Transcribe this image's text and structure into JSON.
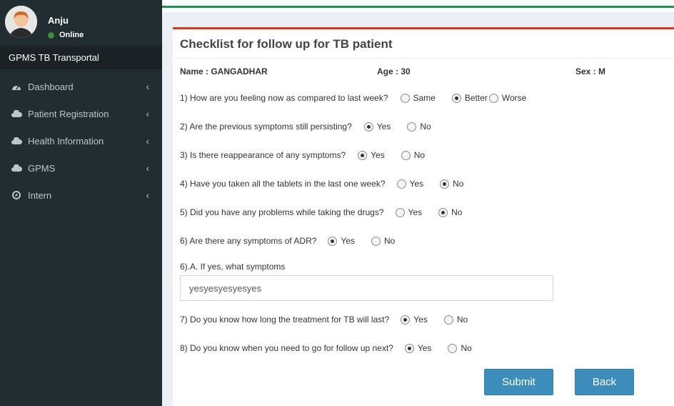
{
  "user": {
    "name": "Anju",
    "status": "Online"
  },
  "app_title": "GPMS TB Transportal",
  "menu": [
    {
      "label": "Dashboard",
      "icon": "dashboard-icon"
    },
    {
      "label": "Patient Registration",
      "icon": "cloud-icon"
    },
    {
      "label": "Health Information",
      "icon": "cloud-icon"
    },
    {
      "label": "GPMS",
      "icon": "cloud-icon"
    },
    {
      "label": "Intern",
      "icon": "compass-icon"
    }
  ],
  "form": {
    "title": "Checklist for follow up for TB patient",
    "name": "Name : GANGADHAR",
    "age": "Age : 30",
    "sex": "Sex : M",
    "q1": {
      "text": "1) How are you feeling now as compared to last week?",
      "options": [
        "Same",
        "Better",
        "Worse"
      ],
      "selected": "Better"
    },
    "q2": {
      "text": "2) Are the previous symptoms still persisting?",
      "options": [
        "Yes",
        "No"
      ],
      "selected": "Yes"
    },
    "q3": {
      "text": "3) Is there reappearance of any symptoms?",
      "options": [
        "Yes",
        "No"
      ],
      "selected": "Yes"
    },
    "q4": {
      "text": "4) Have you taken all the tablets in the last one week?",
      "options": [
        "Yes",
        "No"
      ],
      "selected": "No"
    },
    "q5": {
      "text": "5) Did you have any problems while taking the drugs?",
      "options": [
        "Yes",
        "No"
      ],
      "selected": "No"
    },
    "q6": {
      "text": "6) Are there any symptoms of ADR?",
      "options": [
        "Yes",
        "No"
      ],
      "selected": "Yes"
    },
    "q6a": {
      "label": "6).A. If yes, what symptoms",
      "value": "yesyesyesyesyes"
    },
    "q7": {
      "text": "7) Do you know how long the treatment for TB will last?",
      "options": [
        "Yes",
        "No"
      ],
      "selected": "Yes"
    },
    "q8": {
      "text": "8) Do you know when you need to go for follow up next?",
      "options": [
        "Yes",
        "No"
      ],
      "selected": "Yes"
    },
    "submit_label": "Submit",
    "back_label": "Back"
  }
}
